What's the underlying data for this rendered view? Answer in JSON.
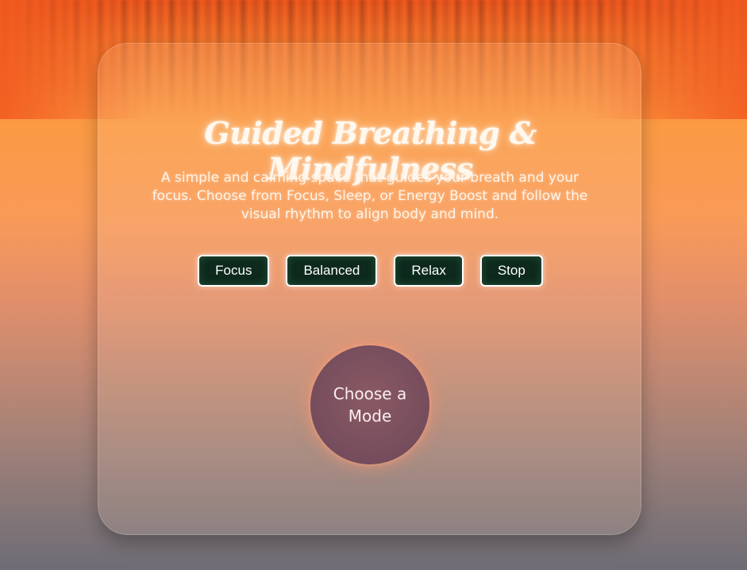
{
  "app": {
    "title": "Guided Breathing & Mindfulness",
    "description": "A simple and calming space that guides your breath and your focus. Choose from Focus, Sleep, or Energy Boost and follow the visual rhythm to align body and mind."
  },
  "modes": [
    {
      "label": "Focus"
    },
    {
      "label": "Balanced"
    },
    {
      "label": "Relax"
    },
    {
      "label": "Stop"
    }
  ],
  "orb": {
    "status_text": "Choose a Mode"
  },
  "colors": {
    "button_bg": "#0d2a1c",
    "button_border": "#ffffff",
    "orb": "#7a4f5e",
    "background_top": "#f25a1f",
    "background_bottom": "#6e6c75"
  }
}
